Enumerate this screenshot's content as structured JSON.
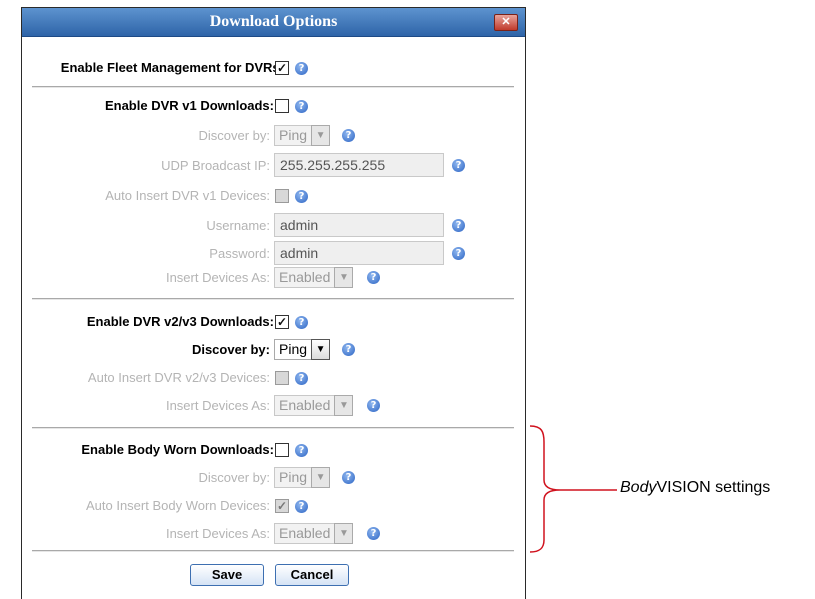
{
  "dialog": {
    "title": "Download Options",
    "close_glyph": "✕"
  },
  "fleet": {
    "label": "Enable Fleet Management for DVRs:",
    "checked": true
  },
  "v1": {
    "enable_label": "Enable DVR v1 Downloads:",
    "discover_label": "Discover by:",
    "discover_value": "Ping",
    "udp_label": "UDP Broadcast IP:",
    "udp_value": "255.255.255.255",
    "auto_insert_label": "Auto Insert DVR v1 Devices:",
    "username_label": "Username:",
    "username_value": "admin",
    "password_label": "Password:",
    "password_value": "admin",
    "insert_as_label": "Insert Devices As:",
    "insert_as_value": "Enabled"
  },
  "v2v3": {
    "enable_label": "Enable DVR v2/v3 Downloads:",
    "discover_label": "Discover by:",
    "discover_value": "Ping",
    "auto_insert_label": "Auto Insert DVR v2/v3 Devices:",
    "insert_as_label": "Insert Devices As:",
    "insert_as_value": "Enabled"
  },
  "bodyworn": {
    "enable_label": "Enable Body Worn Downloads:",
    "discover_label": "Discover by:",
    "discover_value": "Ping",
    "auto_insert_label": "Auto Insert Body Worn Devices:",
    "insert_as_label": "Insert Devices As:",
    "insert_as_value": "Enabled"
  },
  "buttons": {
    "save": "Save",
    "cancel": "Cancel"
  },
  "annotation": {
    "italic": "Body",
    "rest": "VISION settings"
  },
  "colors": {
    "title_bar": "#2e64a8",
    "annotation_bracket": "#d0121e",
    "help_icon": "#2c64c4"
  }
}
